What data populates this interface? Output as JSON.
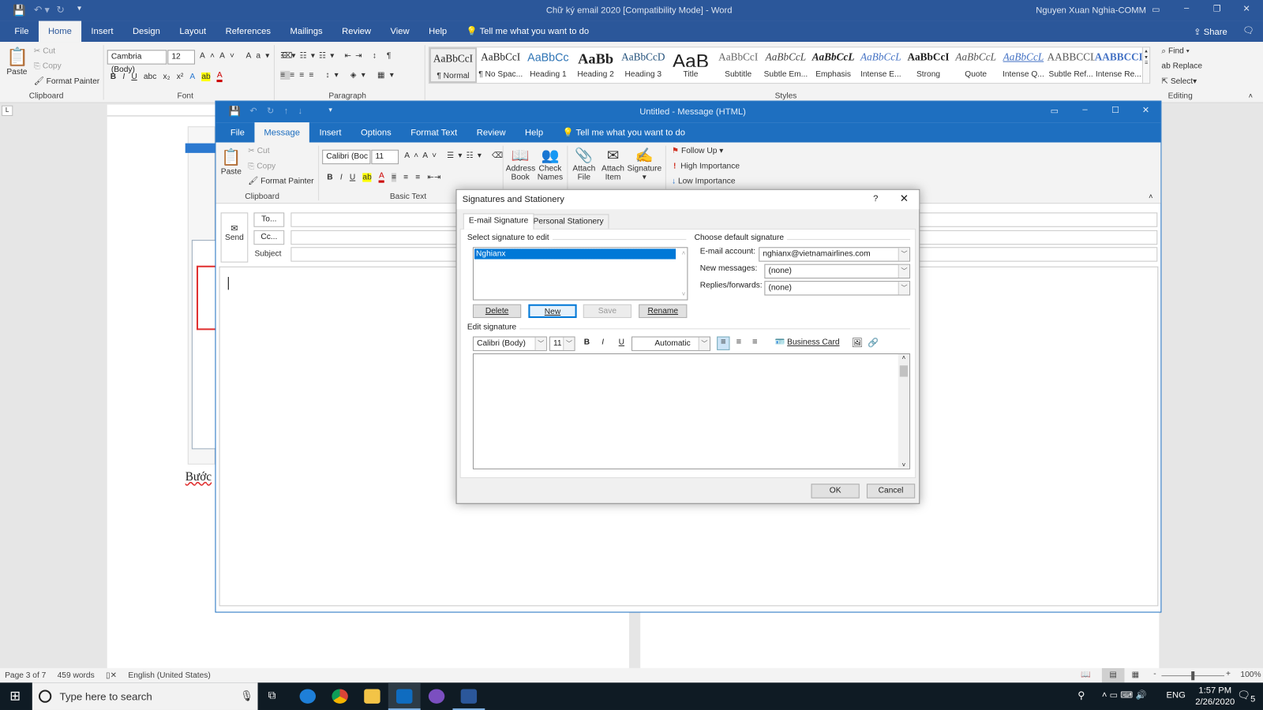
{
  "word": {
    "title": "Chữ ký email 2020 [Compatibility Mode]  -  Word",
    "user": "Nguyen Xuan Nghia-COMM",
    "tabs": [
      "File",
      "Home",
      "Insert",
      "Design",
      "Layout",
      "References",
      "Mailings",
      "Review",
      "View",
      "Help"
    ],
    "active_tab": "Home",
    "tell_me": "Tell me what you want to do",
    "share": "Share",
    "clipboard": {
      "paste": "Paste",
      "cut": "Cut",
      "copy": "Copy",
      "format_painter": "Format Painter",
      "label": "Clipboard"
    },
    "font": {
      "name": "Cambria (Body)",
      "size": "12",
      "label": "Font"
    },
    "paragraph_label": "Paragraph",
    "styles": [
      {
        "preview": "AaBbCcI",
        "name": "¶ Normal"
      },
      {
        "preview": "AaBbCcI",
        "name": "¶ No Spac..."
      },
      {
        "preview": "AaBbCc",
        "name": "Heading 1"
      },
      {
        "preview": "AaBb",
        "name": "Heading 2"
      },
      {
        "preview": "AaBbCcD",
        "name": "Heading 3"
      },
      {
        "preview": "AaB",
        "name": "Title"
      },
      {
        "preview": "AaBbCcI",
        "name": "Subtitle"
      },
      {
        "preview": "AaBbCcL",
        "name": "Subtle Em..."
      },
      {
        "preview": "AaBbCcL",
        "name": "Emphasis"
      },
      {
        "preview": "AaBbCcL",
        "name": "Intense E..."
      },
      {
        "preview": "AaBbCcI",
        "name": "Strong"
      },
      {
        "preview": "AaBbCcL",
        "name": "Quote"
      },
      {
        "preview": "AaBbCcL",
        "name": "Intense Q..."
      },
      {
        "preview": "AABBCCL",
        "name": "Subtle Ref..."
      },
      {
        "preview": "AABBCCL",
        "name": "Intense Re..."
      }
    ],
    "styles_label": "Styles",
    "editing": {
      "find": "Find",
      "replace": "Replace",
      "select": "Select",
      "label": "Editing"
    },
    "doc_text": "Bước",
    "status": {
      "page": "Page 3 of 7",
      "words": "459 words",
      "language": "English (United States)",
      "zoom": "100%"
    }
  },
  "outlook": {
    "title": "Untitled  -  Message (HTML)",
    "tabs": [
      "File",
      "Message",
      "Insert",
      "Options",
      "Format Text",
      "Review",
      "Help"
    ],
    "active_tab": "Message",
    "tell_me": "Tell me what you want to do",
    "clipboard": {
      "paste": "Paste",
      "cut": "Cut",
      "copy": "Copy",
      "format_painter": "Format Painter",
      "label": "Clipboard"
    },
    "font": {
      "name": "Calibri (Boc",
      "size": "11"
    },
    "basic_text_label": "Basic Text",
    "address_book": [
      "Address",
      "Book"
    ],
    "check_names": [
      "Check",
      "Names"
    ],
    "attach_file": [
      "Attach",
      "File"
    ],
    "attach_item": [
      "Attach",
      "Item"
    ],
    "signature": "Signature",
    "follow_up": "Follow Up",
    "high_importance": "High Importance",
    "low_importance": "Low Importance",
    "send": "Send",
    "to": "To...",
    "cc": "Cc...",
    "subject": "Subject"
  },
  "dialog": {
    "title": "Signatures and Stationery",
    "help": "?",
    "tabs": [
      "E-mail Signature",
      "Personal Stationery"
    ],
    "select_label": "Select signature to edit",
    "signatures": [
      "Nghianx"
    ],
    "buttons": {
      "delete": "Delete",
      "new": "New",
      "save": "Save",
      "rename": "Rename",
      "ok": "OK",
      "cancel": "Cancel"
    },
    "default_label": "Choose default signature",
    "email_account_label": "E-mail account:",
    "email_account": "nghianx@vietnamairlines.com",
    "new_messages_label": "New messages:",
    "new_messages": "(none)",
    "replies_label": "Replies/forwards:",
    "replies": "(none)",
    "edit_label": "Edit signature",
    "font": "Calibri (Body)",
    "size": "11",
    "color": "Automatic",
    "business_card": "Business Card"
  },
  "taskbar": {
    "search_placeholder": "Type here to search",
    "lang": "ENG",
    "time": "1:57 PM",
    "date": "2/26/2020",
    "notifications": "5"
  },
  "colors": {
    "word_blue": "#2b579a",
    "outlook_blue": "#1e6fc0",
    "selection": "#0078d7"
  }
}
